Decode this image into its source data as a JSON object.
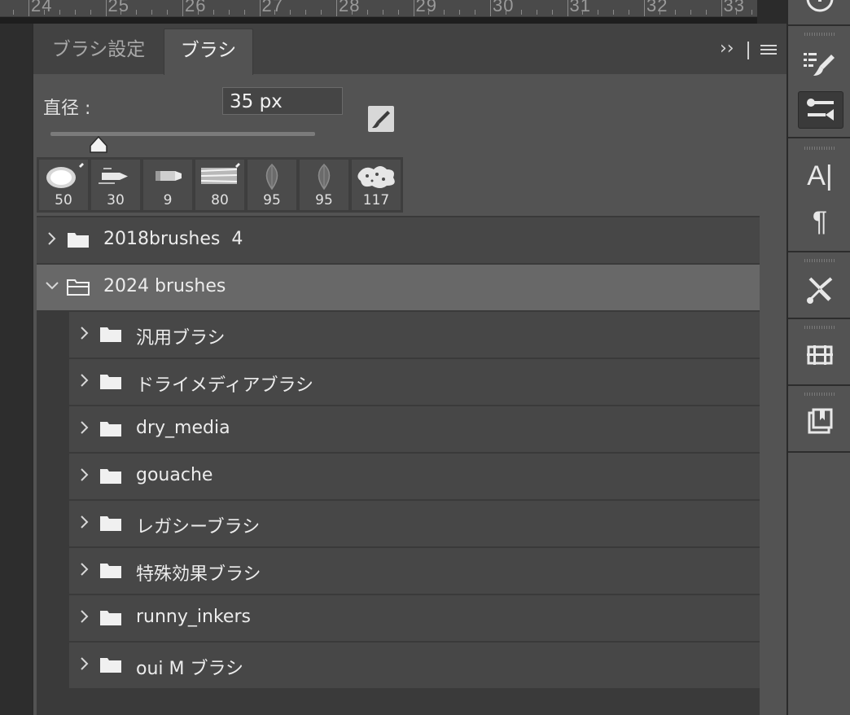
{
  "ruler": {
    "labels": [
      "24",
      "25",
      "26",
      "27",
      "28",
      "29",
      "30",
      "31",
      "32",
      "33"
    ]
  },
  "tabs": [
    {
      "label": "ブラシ設定",
      "active": false
    },
    {
      "label": "ブラシ",
      "active": true
    }
  ],
  "tab_controls": {
    "collapse": "››"
  },
  "diameter": {
    "label": "直径 :",
    "value": "35 px",
    "slider_fraction": 0.16
  },
  "presets": [
    {
      "size": "50",
      "icon": "soft-round-brush-icon"
    },
    {
      "size": "30",
      "icon": "pen-brush-icon"
    },
    {
      "size": "9",
      "icon": "marker-brush-icon"
    },
    {
      "size": "80",
      "icon": "texture-brush-icon"
    },
    {
      "size": "95",
      "icon": "leaf-brush-icon"
    },
    {
      "size": "95",
      "icon": "leaf-brush-icon"
    },
    {
      "size": "117",
      "icon": "splatter-brush-icon"
    }
  ],
  "groups": [
    {
      "label": "2018brushes  4",
      "expanded": false,
      "level": 0
    },
    {
      "label": "2024 brushes",
      "expanded": true,
      "level": 0,
      "selected": true
    },
    {
      "label": "汎用ブラシ",
      "expanded": false,
      "level": 1
    },
    {
      "label": "ドライメディアブラシ",
      "expanded": false,
      "level": 1
    },
    {
      "label": "dry_media",
      "expanded": false,
      "level": 1
    },
    {
      "label": "gouache",
      "expanded": false,
      "level": 1
    },
    {
      "label": "レガシーブラシ",
      "expanded": false,
      "level": 1
    },
    {
      "label": "特殊効果ブラシ",
      "expanded": false,
      "level": 1
    },
    {
      "label": "runny_inkers",
      "expanded": false,
      "level": 1
    },
    {
      "label": "oui M ブラシ",
      "expanded": false,
      "level": 1
    }
  ],
  "right_toolbar": {
    "character_glyph": "A|",
    "paragraph_glyph": "¶",
    "icons": [
      "info-icon",
      "brush-list-icon",
      "brush-settings-icon",
      "character-icon",
      "paragraph-icon",
      "tool-presets-icon",
      "clone-source-icon",
      "layer-comps-icon"
    ]
  },
  "colors": {
    "panel": "#535353",
    "list_row": "#474747",
    "selected_row": "#686868",
    "background": "#2b2b2b"
  }
}
